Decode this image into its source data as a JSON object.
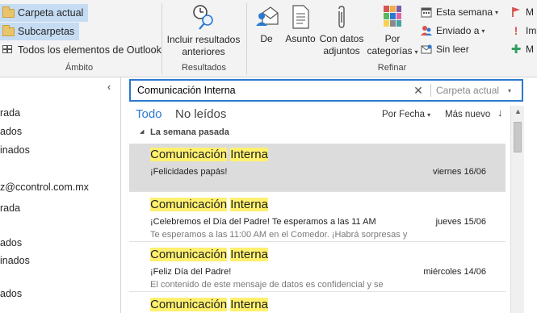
{
  "ribbon": {
    "scope": {
      "current_folder": "Carpeta actual",
      "subfolders": "Subcarpetas",
      "all_items": "Todos los elementos de Outlook",
      "group_label": "Ámbito"
    },
    "results": {
      "include_line1": "Incluir resultados",
      "include_line2": "anteriores",
      "group_label": "Resultados"
    },
    "refine": {
      "from": "De",
      "subject": "Asunto",
      "attachments_line1": "Con datos",
      "attachments_line2": "adjuntos",
      "categories_line1": "Por",
      "categories_line2": "categorías",
      "this_week": "Esta semana",
      "sent_to": "Enviado a",
      "unread": "Sin leer",
      "flag_cut": "M",
      "important_cut": "Imp",
      "more_cut": "M",
      "group_label": "Refinar"
    }
  },
  "folders": {
    "lines": [
      "rada",
      "ados",
      "inados",
      "z@ccontrol.com.mx",
      "rada",
      "ados",
      "inados",
      "ados"
    ]
  },
  "search": {
    "value": "Comunicación Interna",
    "scope": "Carpeta actual",
    "clear_glyph": "✕"
  },
  "filters": {
    "all": "Todo",
    "unread": "No leídos",
    "sort": "Por Fecha",
    "order": "Más nuevo"
  },
  "group_header": "La semana pasada",
  "messages": [
    {
      "sender_a": "Comunicación",
      "sender_b": "Interna",
      "subject": "¡Felicidades papás!",
      "date": "viernes 16/06",
      "preview": ""
    },
    {
      "sender_a": "Comunicación",
      "sender_b": "Interna",
      "subject": "¡Celebremos el Día del Padre! Te esperamos a las 11 AM",
      "date": "jueves 15/06",
      "preview": "Te esperamos a las 11:00 AM en el Comedor. ¡Habrá sorpresas y"
    },
    {
      "sender_a": "Comunicación",
      "sender_b": "Interna",
      "subject": "¡Feliz Día del Padre!",
      "date": "miércoles 14/06",
      "preview": "El contenido de este mensaje de datos es confidencial y se"
    },
    {
      "sender_a": "Comunicación",
      "sender_b": "Interna",
      "subject": "",
      "date": "",
      "preview": ""
    }
  ],
  "colors": {
    "accent": "#2b79d0",
    "highlight": "#fff06e",
    "selected_row": "#dcdcdc",
    "scope_selected": "#c5dcf3"
  }
}
